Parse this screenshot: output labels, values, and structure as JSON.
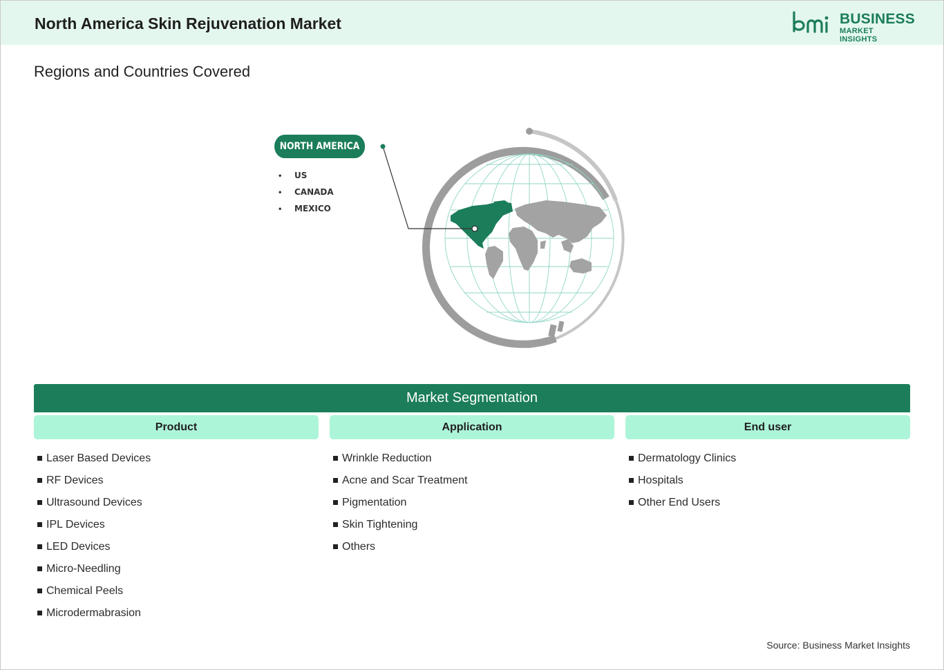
{
  "header": {
    "title": "North America Skin Rejuvenation Market",
    "logo_line1": "BUSINESS",
    "logo_line2": "MARKET INSIGHTS"
  },
  "regions": {
    "title": "Regions and Countries Covered",
    "region_name": "NORTH AMERICA",
    "countries": [
      "US",
      "CANADA",
      "MEXICO"
    ]
  },
  "segmentation": {
    "title": "Market Segmentation",
    "columns": [
      {
        "heading": "Product",
        "items": [
          "Laser Based Devices",
          "RF Devices",
          "Ultrasound Devices",
          "IPL Devices",
          "LED Devices",
          "Micro-Needling",
          "Chemical Peels",
          "Microdermabrasion"
        ]
      },
      {
        "heading": "Application",
        "items": [
          "Wrinkle Reduction",
          "Acne and Scar Treatment",
          "Pigmentation",
          "Skin Tightening",
          "Others"
        ]
      },
      {
        "heading": "End user",
        "items": [
          "Dermatology Clinics",
          "Hospitals",
          "Other End Users"
        ]
      }
    ]
  },
  "source": "Source: Business Market Insights",
  "colors": {
    "brand_green": "#1b7d5a",
    "header_bg": "#e4f7ee",
    "column_head_bg": "#adf5d8",
    "map_gray": "#a3a3a3"
  },
  "icons": [
    "bmi-logo-icon",
    "world-globe-icon",
    "location-pin-icon",
    "bullet-square-icon"
  ]
}
